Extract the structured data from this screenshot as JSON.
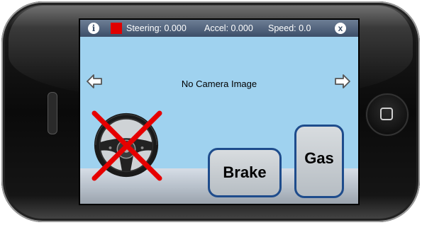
{
  "status_bar": {
    "steering_label": "Steering: 0.000",
    "accel_label": "Accel: 0.000",
    "speed_label": "Speed: 0.0",
    "info_glyph": "i",
    "close_glyph": "x",
    "stop_color": "#e00000"
  },
  "camera": {
    "message": "No Camera Image"
  },
  "controls": {
    "brake_label": "Brake",
    "gas_label": "Gas",
    "steering_disabled": true
  },
  "colors": {
    "screen_bg": "#9fd2ef",
    "button_border": "#1e4c8c",
    "cross_color": "#e60000"
  },
  "icons": {
    "left": "left-arrow-icon",
    "right": "right-arrow-icon",
    "wheel": "steering-wheel-icon"
  }
}
